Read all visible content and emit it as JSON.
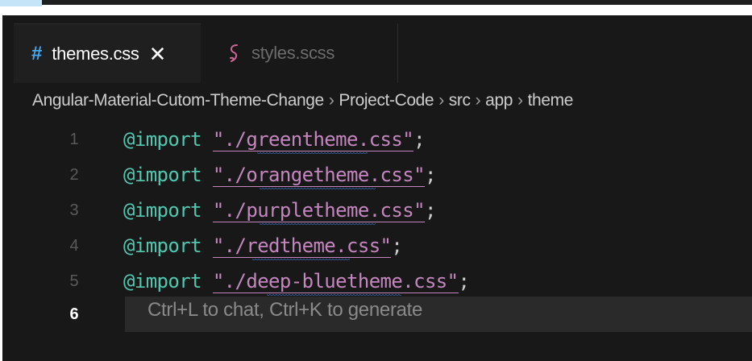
{
  "tabs": [
    {
      "icon": "css-hash-icon",
      "glyph": "#",
      "label": "themes.css",
      "close": "✕",
      "active": true
    },
    {
      "icon": "sass-icon",
      "label": "styles.scss",
      "active": false
    }
  ],
  "breadcrumb": {
    "items": [
      "Angular-Material-Cutom-Theme-Change",
      "Project-Code",
      "src",
      "app",
      "theme"
    ],
    "separator": "›"
  },
  "code": {
    "lines": [
      {
        "number": "1",
        "keyword": "@import",
        "string": "\"./greentheme.css\"",
        "end": ";"
      },
      {
        "number": "2",
        "keyword": "@import",
        "string": "\"./orangetheme.css\"",
        "end": ";"
      },
      {
        "number": "3",
        "keyword": "@import",
        "string": "\"./purpletheme.css\"",
        "end": ";"
      },
      {
        "number": "4",
        "keyword": "@import",
        "string": "\"./redtheme.css\"",
        "end": ";"
      },
      {
        "number": "5",
        "keyword": "@import",
        "string": "\"./deep-bluetheme.css\"",
        "end": ";"
      },
      {
        "number": "6"
      }
    ],
    "hint": "Ctrl+L to chat, Ctrl+K to generate",
    "current_line": 6
  },
  "colors": {
    "background": "#181818",
    "keyword": "#4ec9b0",
    "string": "#c586c0",
    "css_icon": "#4aa8f0",
    "sass_icon": "#cd6799"
  }
}
